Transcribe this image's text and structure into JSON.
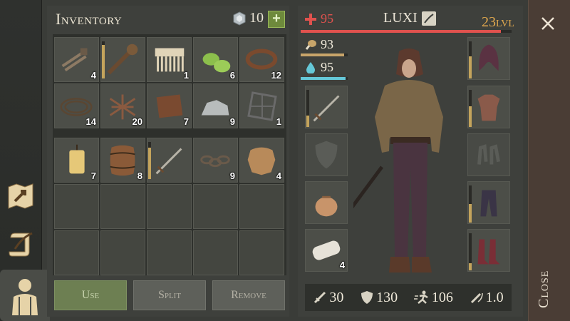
{
  "colors": {
    "health": "#e0524e",
    "food": "#c8a56a",
    "water": "#65c8d8",
    "level": "#e0a84e",
    "use_button": "#6d7f52"
  },
  "inventory": {
    "title": "Inventory",
    "gems": "10",
    "add_label": "+",
    "items": [
      {
        "icon": "nails-icon",
        "qty": "4"
      },
      {
        "icon": "spiked-club-icon",
        "qty": "",
        "durability": 0.9
      },
      {
        "icon": "bone-comb-icon",
        "qty": "1"
      },
      {
        "icon": "green-slippers-icon",
        "qty": "6"
      },
      {
        "icon": "leather-strap-icon",
        "qty": "12"
      },
      {
        "icon": "rope-icon",
        "qty": "14"
      },
      {
        "icon": "fibers-icon",
        "qty": "20"
      },
      {
        "icon": "leather-scroll-icon",
        "qty": "7"
      },
      {
        "icon": "stone-ore-icon",
        "qty": "9"
      },
      {
        "icon": "iron-grate-icon",
        "qty": "1"
      },
      {
        "icon": "candle-icon",
        "qty": "7"
      },
      {
        "icon": "barrel-icon",
        "qty": "8"
      },
      {
        "icon": "sword-icon",
        "qty": "",
        "durability": 0.85
      },
      {
        "icon": "chain-icon",
        "qty": "9"
      },
      {
        "icon": "animal-hide-icon",
        "qty": "4"
      }
    ],
    "buttons": {
      "use": "Use",
      "split": "Split",
      "remove": "Remove"
    }
  },
  "character": {
    "health": "95",
    "food": "93",
    "water": "95",
    "health_fill": 0.95,
    "food_fill": 0.93,
    "water_fill": 0.95,
    "name": "LUXI",
    "level": "23",
    "level_unit": "LVL",
    "left_slots": [
      {
        "icon": "sword-icon",
        "durability": 0.3
      },
      {
        "icon": "shield-slot-icon",
        "empty": true
      },
      {
        "icon": "pouch-icon"
      },
      {
        "icon": "bandage-roll-icon",
        "qty": "4"
      }
    ],
    "right_slots": [
      {
        "icon": "hood-icon",
        "durability": 0.6
      },
      {
        "icon": "tunic-icon",
        "durability": 0.55
      },
      {
        "icon": "gloves-slot-icon",
        "empty": true
      },
      {
        "icon": "pants-icon",
        "durability": 0.5
      },
      {
        "icon": "boots-icon",
        "durability": 0.2
      }
    ],
    "stats": {
      "attack": "30",
      "defense": "130",
      "speed": "106",
      "weight": "1.0"
    }
  },
  "close_label": "Close"
}
